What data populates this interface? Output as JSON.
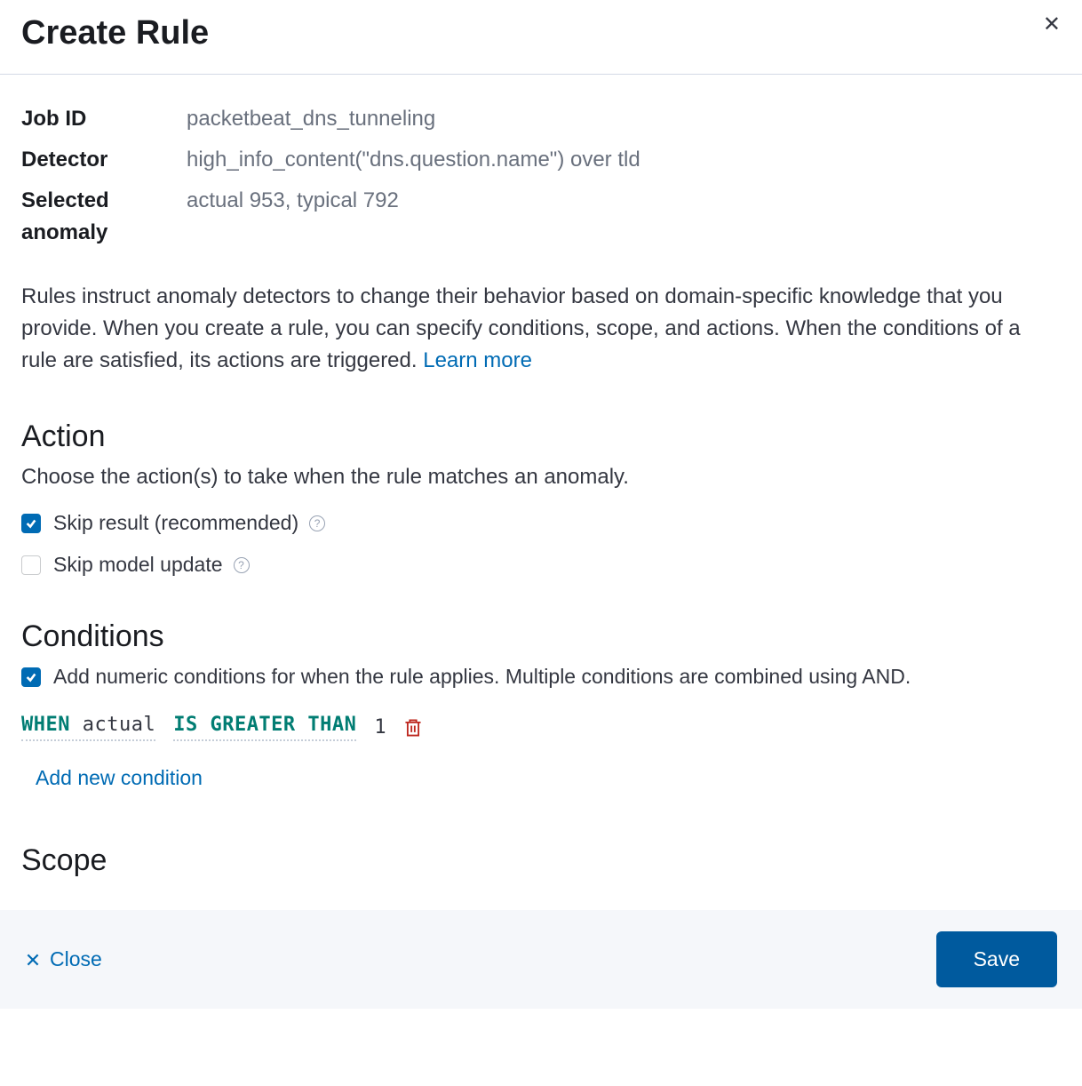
{
  "header": {
    "title": "Create Rule"
  },
  "meta": {
    "job_id_label": "Job ID",
    "job_id_value": "packetbeat_dns_tunneling",
    "detector_label": "Detector",
    "detector_value": "high_info_content(\"dns.question.name\") over tld",
    "anomaly_label": "Selected anomaly",
    "anomaly_value": "actual 953, typical 792"
  },
  "description": {
    "text": "Rules instruct anomaly detectors to change their behavior based on domain-specific knowledge that you provide. When you create a rule, you can specify conditions, scope, and actions. When the conditions of a rule are satisfied, its actions are triggered. ",
    "link": "Learn more"
  },
  "action": {
    "heading": "Action",
    "desc": "Choose the action(s) to take when the rule matches an anomaly.",
    "skip_result_label": "Skip result (recommended)",
    "skip_model_label": "Skip model update"
  },
  "conditions": {
    "heading": "Conditions",
    "enable_label": "Add numeric conditions for when the rule applies. Multiple conditions are combined using AND.",
    "row": {
      "when": "WHEN",
      "field": "actual",
      "op": "IS GREATER THAN",
      "value": "1"
    },
    "add_new": "Add new condition"
  },
  "scope": {
    "heading": "Scope"
  },
  "footer": {
    "close": "Close",
    "save": "Save"
  }
}
